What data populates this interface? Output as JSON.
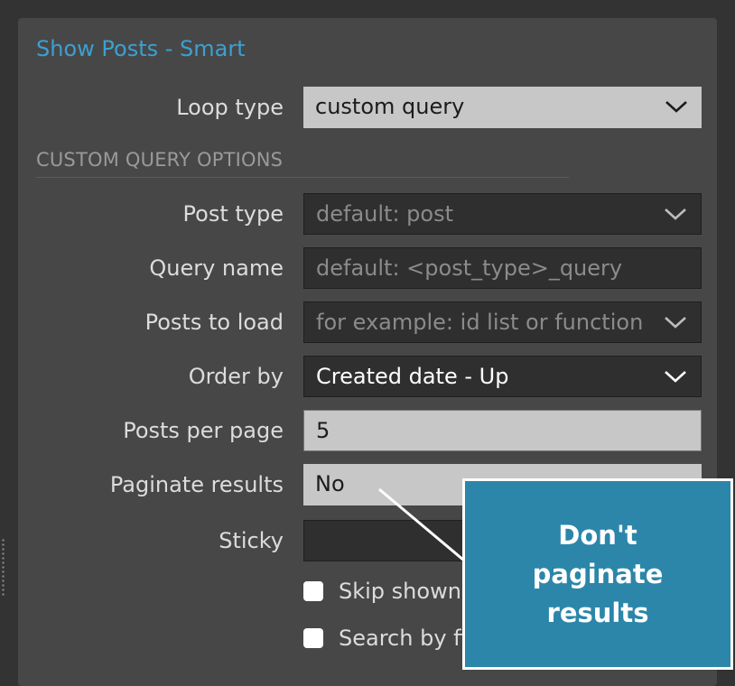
{
  "panel": {
    "title": "Show Posts - Smart"
  },
  "loop_type": {
    "label": "Loop type",
    "value": "custom query"
  },
  "section": {
    "heading": "CUSTOM QUERY OPTIONS"
  },
  "post_type": {
    "label": "Post type",
    "placeholder": "default: post"
  },
  "query_name": {
    "label": "Query name",
    "placeholder": "default: <post_type>_query"
  },
  "posts_to_load": {
    "label": "Posts to load",
    "placeholder": "for example: id list or function"
  },
  "order_by": {
    "label": "Order by",
    "value": "Created date - Up"
  },
  "posts_per_page": {
    "label": "Posts per page",
    "value": "5"
  },
  "paginate_results": {
    "label": "Paginate results",
    "value": "No"
  },
  "sticky": {
    "label": "Sticky",
    "value": ""
  },
  "checkboxes": [
    {
      "label": "Skip shown",
      "checked": false
    },
    {
      "label": "Search by fi",
      "checked": false
    }
  ],
  "callout": {
    "text": "Don't paginate results"
  },
  "colors": {
    "accent": "#3ca0d2",
    "callout_bg": "#2c86aa",
    "panel_bg": "#474747"
  },
  "icons": {
    "dropdown": "chevron-down-icon",
    "grip": "drag-handle-icon"
  }
}
